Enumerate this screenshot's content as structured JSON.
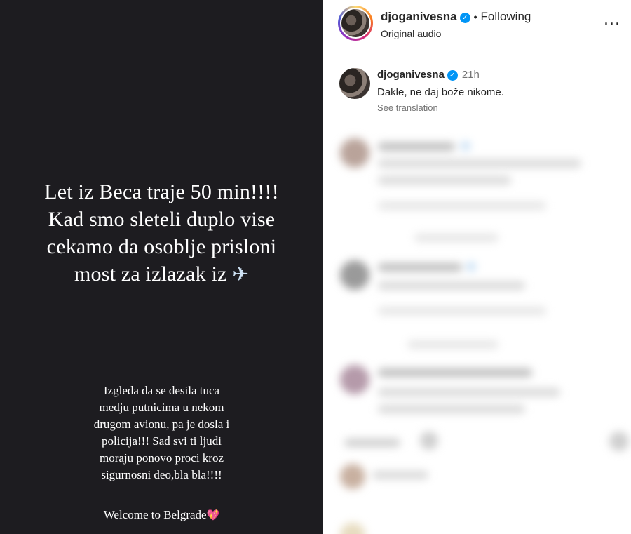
{
  "story": {
    "headline_lines": [
      "Let iz Beca traje 50 min!!!!",
      "Kad smo sleteli duplo vise",
      "cekamo da osoblje prisloni",
      "most za izlazak iz"
    ],
    "plane_icon": "airplane-icon",
    "body_lines": [
      "Izgleda da se desila tuca",
      "medju putnicima u nekom",
      "drugom avionu, pa je dosla i",
      "policija!!! Sad svi ti ljudi",
      "moraju ponovo proci kroz",
      "sigurnosni deo,bla bla!!!!"
    ],
    "footer": "Welcome to Belgrade",
    "heart_icon": "sparkling-heart-icon"
  },
  "post_header": {
    "username": "djoganivesna",
    "separator": "•",
    "follow_status": "Following",
    "audio": "Original audio",
    "more": "..."
  },
  "caption": {
    "username": "djoganivesna",
    "time": "21h",
    "text": "Dakle, ne daj bože nikome.",
    "translate": "See translation"
  },
  "colors": {
    "story_bg": "#1d1c20",
    "verified": "#0095f6",
    "secondary_text": "#737373"
  }
}
